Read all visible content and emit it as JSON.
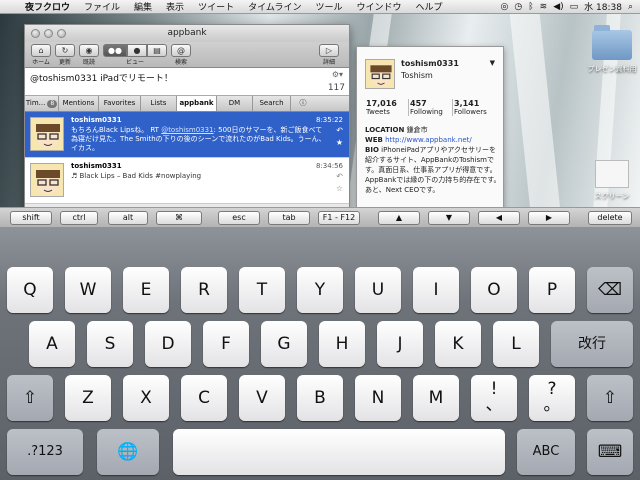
{
  "menubar": {
    "app_name": "夜フクロウ",
    "items": [
      "ファイル",
      "編集",
      "表示",
      "ツイート",
      "タイムライン",
      "ツール",
      "ウインドウ",
      "ヘルプ"
    ],
    "clock": "水 18:38"
  },
  "window": {
    "title": "appbank",
    "toolbar": {
      "home": "ホーム",
      "refresh": "更新",
      "read": "既読",
      "view": "ビュー",
      "search": "検索",
      "details": "詳細"
    },
    "compose_text": "@toshism0331 iPadでリモート！",
    "char_count": "117",
    "tabs": [
      {
        "label": "Tim...",
        "badge": "8"
      },
      {
        "label": "Mentions"
      },
      {
        "label": "Favorites"
      },
      {
        "label": "Lists"
      },
      {
        "label": "appbank"
      },
      {
        "label": "DM"
      },
      {
        "label": "Search"
      }
    ],
    "tweets": [
      {
        "user": "toshism0331",
        "time": "8:35:22",
        "text_pre": "もちろんBlack Lipsね。 RT ",
        "mention": "@toshism0331",
        "text_post": ": 500日のサマーを、新ご飯食べて為寝だけ見た。The Smithの下りの後のシーンで流れたのがBad Kids。うーん、イカス。"
      },
      {
        "user": "toshism0331",
        "time": "8:34:56",
        "text": "♬ Black Lips – Bad Kids #nowplaying"
      }
    ]
  },
  "profile": {
    "handle": "toshism0331",
    "name": "Toshism",
    "tweets_count": "17,016",
    "tweets_label": "Tweets",
    "following_count": "457",
    "following_label": "Following",
    "followers_count": "3,141",
    "followers_label": "Followers",
    "location_label": "LOCATION",
    "location": "鎌倉市",
    "web_label": "WEB",
    "web": "http://www.appbank.net/",
    "bio_label": "BIO",
    "bio": "iPhoneiPadアプリやアクセサリーを紹介するサイト、AppBankのToshismです。真面日系、仕事系アプリが得意です。AppBankでは縁の下の力持ち的存在です。あと、Next CEOです。"
  },
  "desktop_icons": {
    "folder_label": "プレゼン資料用",
    "screenshot_label": "スクリーン"
  },
  "special_keys": [
    "shift",
    "ctrl",
    "alt",
    "⌘",
    "esc",
    "tab",
    "F1 - F12",
    "▲",
    "▼",
    "◀",
    "▶",
    "delete"
  ],
  "keyboard": {
    "row1": [
      "Q",
      "W",
      "E",
      "R",
      "T",
      "Y",
      "U",
      "I",
      "O",
      "P"
    ],
    "row2": [
      "A",
      "S",
      "D",
      "F",
      "G",
      "H",
      "J",
      "K",
      "L"
    ],
    "return_label": "改行",
    "row3": [
      "Z",
      "X",
      "C",
      "V",
      "B",
      "N",
      "M"
    ],
    "punct1_top": "!",
    "punct1_bottom": "、",
    "punct2_top": "?",
    "punct2_bottom": "。",
    "numbers_label": ".?123",
    "abc_label": "ABC",
    "backspace_icon": "⌫",
    "shift_icon": "⇧",
    "globe_icon": "🌐",
    "hide_keyboard_icon": "⌨"
  }
}
